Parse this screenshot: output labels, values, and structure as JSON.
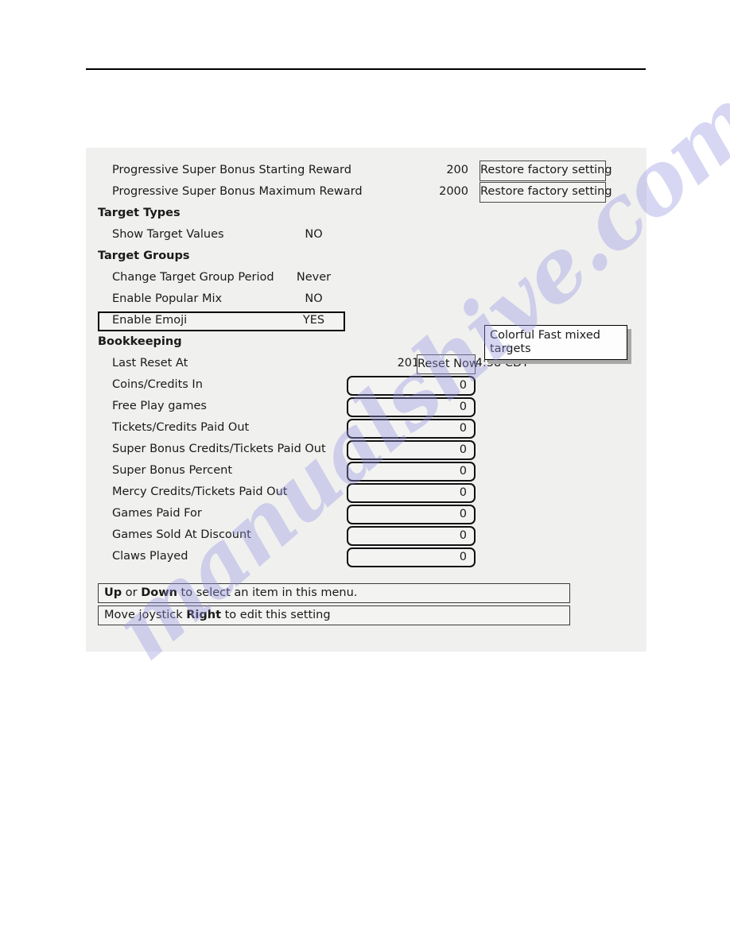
{
  "document": {
    "watermark": "manualshive.com"
  },
  "panel": {
    "rows": [
      {
        "kind": "setting",
        "label": "Progressive Super Bonus Starting Reward",
        "value": "200",
        "value_style": "num",
        "button": "Restore factory setting"
      },
      {
        "kind": "setting",
        "label": "Progressive Super Bonus Maximum Reward",
        "value": "2000",
        "value_style": "num",
        "button": "Restore factory setting"
      },
      {
        "kind": "section",
        "label": "Target Types"
      },
      {
        "kind": "setting",
        "label": "Show Target Values",
        "value": "NO",
        "value_style": "word"
      },
      {
        "kind": "section",
        "label": "Target Groups"
      },
      {
        "kind": "setting",
        "label": "Change Target Group Period",
        "value": "Never",
        "value_style": "word"
      },
      {
        "kind": "setting",
        "label": "Enable Popular Mix",
        "value": "NO",
        "value_style": "word"
      },
      {
        "kind": "setting",
        "label": "Enable Emoji",
        "value": "YES",
        "value_style": "word",
        "selected": true
      },
      {
        "kind": "section",
        "label": "Bookkeeping"
      },
      {
        "kind": "setting",
        "label": "Last Reset At",
        "value": "2018-10-30 14:58 CDT",
        "value_style": "stamp",
        "reset_button": "Reset Now"
      },
      {
        "kind": "field",
        "label": "Coins/Credits In",
        "value": "0"
      },
      {
        "kind": "field",
        "label": "Free Play games",
        "value": "0"
      },
      {
        "kind": "field",
        "label": "Tickets/Credits Paid Out",
        "value": "0"
      },
      {
        "kind": "field",
        "label": "Super Bonus Credits/Tickets Paid Out",
        "value": "0"
      },
      {
        "kind": "field",
        "label": "Super Bonus Percent",
        "value": "0"
      },
      {
        "kind": "field",
        "label": "Mercy Credits/Tickets Paid Out",
        "value": "0"
      },
      {
        "kind": "field",
        "label": "Games Paid For",
        "value": "0"
      },
      {
        "kind": "field",
        "label": "Games Sold At Discount",
        "value": "0"
      },
      {
        "kind": "field",
        "label": "Claws Played",
        "value": "0"
      }
    ],
    "tooltip": {
      "line1": "Colorful Fast mixed",
      "line2": "targets"
    },
    "hints": [
      {
        "parts": [
          {
            "text": "Up",
            "bold": true
          },
          {
            "text": " or ",
            "bold": false
          },
          {
            "text": "Down",
            "bold": true
          },
          {
            "text": " to select an item in this menu.",
            "bold": false
          }
        ]
      },
      {
        "parts": [
          {
            "text": "Move joystick ",
            "bold": false
          },
          {
            "text": "Right",
            "bold": true
          },
          {
            "text": " to edit this setting",
            "bold": false
          }
        ]
      }
    ]
  }
}
